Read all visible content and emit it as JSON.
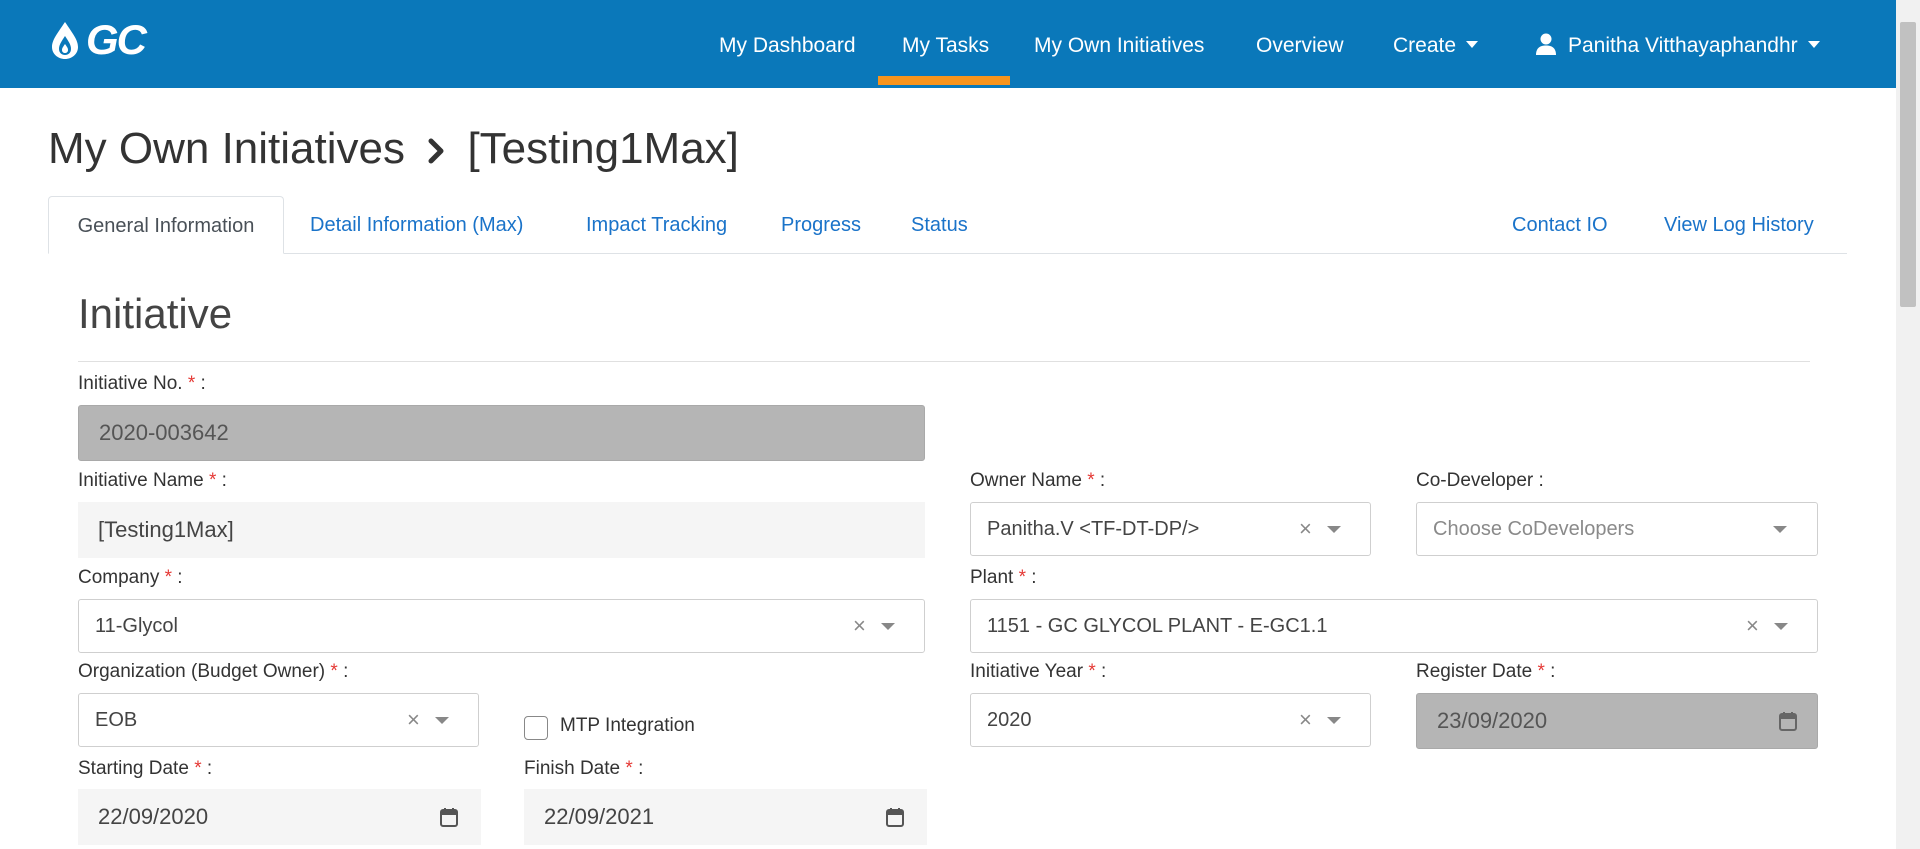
{
  "navbar": {
    "logo_text": "GC",
    "items": [
      {
        "label": "My Dashboard"
      },
      {
        "label": "My Tasks",
        "active": true
      },
      {
        "label": "My Own Initiatives"
      },
      {
        "label": "Overview"
      },
      {
        "label": "Create"
      }
    ],
    "user_name": "Panitha Vitthayaphandhr",
    "brand_color": "#0a78ba",
    "active_color": "#f7941d"
  },
  "breadcrumb": {
    "section": "My Own Initiatives",
    "current": "[Testing1Max]"
  },
  "tabs": [
    {
      "label": "General Information",
      "active": true
    },
    {
      "label": "Detail Information (Max)"
    },
    {
      "label": "Impact Tracking"
    },
    {
      "label": "Progress"
    },
    {
      "label": "Status"
    }
  ],
  "right_links": [
    {
      "label": "Contact IO"
    },
    {
      "label": "View Log History"
    }
  ],
  "form": {
    "section_title": "Initiative",
    "required_mark": "*",
    "initiative_no": {
      "label": "Initiative No.",
      "value": "2020-003642"
    },
    "initiative_name": {
      "label": "Initiative Name",
      "value": "[Testing1Max]"
    },
    "owner_name": {
      "label": "Owner Name",
      "value": "Panitha.V <TF-DT-DP/>"
    },
    "co_developer": {
      "label": "Co-Developer",
      "placeholder": "Choose CoDevelopers"
    },
    "company": {
      "label": "Company",
      "value": "11-Glycol"
    },
    "plant": {
      "label": "Plant",
      "value": "1151 - GC GLYCOL PLANT - E-GC1.1"
    },
    "organization": {
      "label": "Organization (Budget Owner)",
      "value": "EOB"
    },
    "mtp_integration": {
      "label": "MTP Integration",
      "checked": false
    },
    "initiative_year": {
      "label": "Initiative Year",
      "value": "2020"
    },
    "register_date": {
      "label": "Register Date",
      "value": "23/09/2020"
    },
    "starting_date": {
      "label": "Starting Date",
      "value": "22/09/2020"
    },
    "finish_date": {
      "label": "Finish Date",
      "value": "22/09/2021"
    },
    "clear_glyph": "×"
  }
}
